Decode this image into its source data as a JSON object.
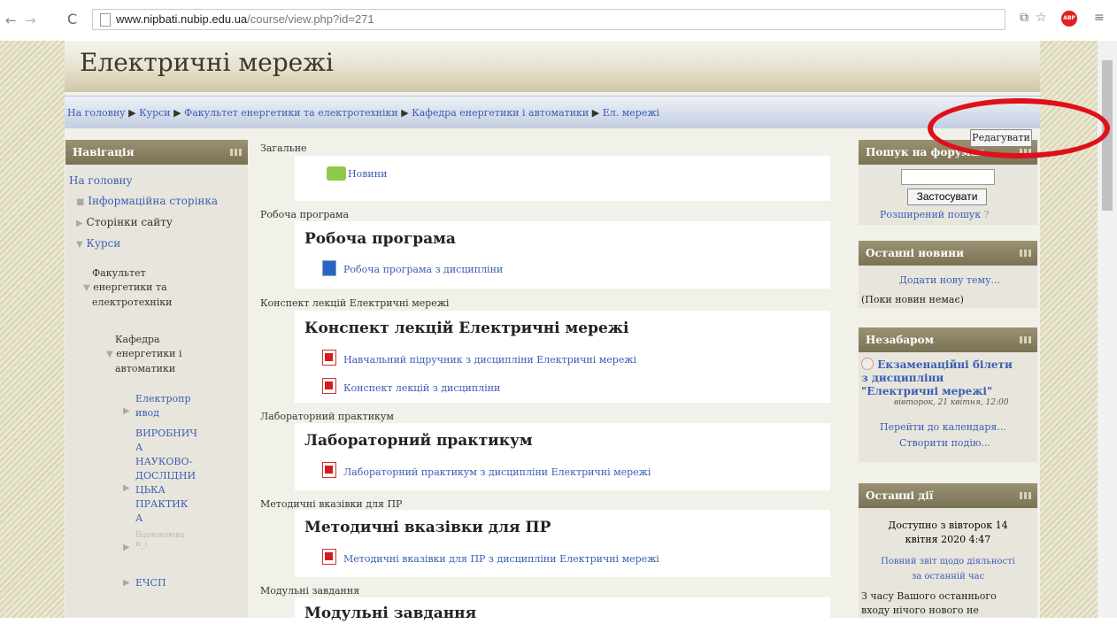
{
  "browser": {
    "url_host": "www.nipbati.nubip.edu.ua",
    "url_path": "/course/view.php?id=271",
    "abp_label": "ABP"
  },
  "header": {
    "title": "Електричні мережі",
    "breadcrumbs": [
      "На головну",
      "Курси",
      "Факультет енергетики та електротехніки",
      "Кафедра енергетики і автоматики",
      "Ел. мережі"
    ],
    "edit_button": "Редагувати"
  },
  "left": {
    "title": "Навігація",
    "home": "На головну",
    "items": [
      "Інформаційна сторінка",
      "Сторінки сайту",
      "Курси"
    ],
    "faculty": [
      "Факультет",
      "енергетики та",
      "електротехніки"
    ],
    "dept": [
      "Кафедра",
      "енергетики і",
      "автоматики"
    ],
    "sub1": [
      "Електропр",
      "ивод"
    ],
    "sub2": [
      "ВИРОБНИЧ",
      "А",
      "НАУКОВО-",
      "ДОСЛІДНИ",
      "ЦЬКА",
      "ПРАКТИК",
      "А"
    ],
    "sub3": "Відновлюва н_і",
    "sub4": "ЕЧСП"
  },
  "center": {
    "s1_label": "Загальне",
    "s1_item": "Новини",
    "s2_label": "Робоча програма",
    "s2_title": "Робоча програма",
    "s2_item": "Робоча програма з дисципліни",
    "s3_label": "Конспект лекцій Електричні мережі",
    "s3_title": "Конспект лекцій Електричні мережі",
    "s3_item1": "Навчальний підручник з дисципліни Електричні мережі",
    "s3_item2": "Конспект лекцій з дисципліни",
    "s4_label": "Лабораторний практикум",
    "s4_title": "Лабораторний практикум",
    "s4_item": "Лабораторний практикум з дисципліни Електричні мережі",
    "s5_label": "Методичні вказівки для ПР",
    "s5_title": "Методичні вказівки для ПР",
    "s5_item": "Методичні вказівки для ПР з дисципліни Електричні мережі",
    "s6_label": "Модульні завдання",
    "s6_title": "Модульні завдання"
  },
  "right": {
    "search_title": "Пошук на форумах",
    "search_btn": "Застосувати",
    "adv_search": "Розширений пошук",
    "news_title": "Останні новини",
    "add_topic": "Додати нову тему...",
    "no_news": "(Поки новин немає)",
    "upcoming_title": "Незабаром",
    "event_l1": "Екзаменаційні білети",
    "event_l2": "з дисципліни",
    "event_l3": "\"Електричні мережі\"",
    "event_date": "вівторок, 21 квітня, 12:00",
    "go_calendar": "Перейти до календаря...",
    "create_event": "Створити подію...",
    "recent_title": "Останні дії",
    "since_l1": "Доступно з вівторок 14",
    "since_l2": "квітня 2020 4:47",
    "full_report_l1": "Повний звіт щодо діяльності",
    "full_report_l2": "за останній час",
    "nothing_l1": "З часу Вашого останнього",
    "nothing_l2": "входу нічого нового не"
  }
}
